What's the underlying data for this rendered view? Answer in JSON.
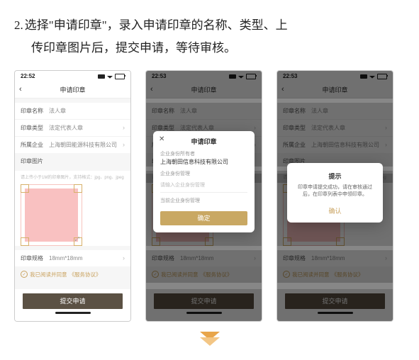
{
  "instruction": {
    "number": "2.",
    "line1": "选择\"申请印章\"，录入申请印章的名称、类型、上",
    "line2": "传印章图片后，提交申请，等待审核。"
  },
  "phone_common": {
    "nav_title": "申请印章",
    "rows": {
      "name_label": "印章名称",
      "name_value": "法人章",
      "type_label": "印章类型",
      "type_value": "法定代表人章",
      "company_label": "所属企业",
      "spec_label": "印章规格",
      "spec_value": "18mm*18mm"
    },
    "image_section_title": "印章图片",
    "image_hint": "请上传小于1M的印章图片，支持格式：jpg、png、jpeg",
    "agree_prefix": "我已阅读并同意",
    "agree_link": "《服务协议》",
    "submit_label": "提交申请"
  },
  "phone1": {
    "time": "22:52",
    "company_value": "上海朝田能源科技有限公司"
  },
  "phone2": {
    "time": "22:53",
    "company_value": "上海朝田信息科技有限公司",
    "modal": {
      "title": "申请印章",
      "section1_label": "企业身份所有者",
      "section1_value": "上海朝田信息科技有限公司",
      "section2_label": "企业身份管理",
      "input_placeholder": "请输入企业身份管理",
      "hint": "当前企业身份管理",
      "confirm": "确定"
    }
  },
  "phone3": {
    "time": "22:53",
    "company_value": "上海朝田信息科技有限公司",
    "alert": {
      "title": "提示",
      "message": "印章申请提交成功，请在审核通过后，在印章列表中申领印章。",
      "ok": "确认"
    }
  }
}
